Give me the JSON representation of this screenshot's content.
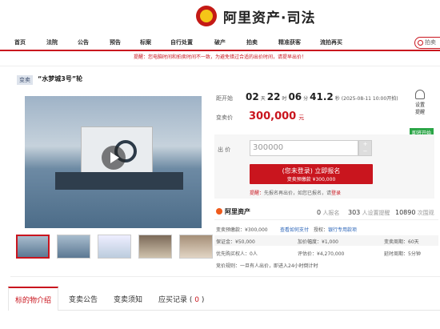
{
  "brand": {
    "name": "阿里资产·司法"
  },
  "nav": {
    "items": [
      "首页",
      "法院",
      "公告",
      "预告",
      "标案",
      "自行处置",
      "破产",
      "拍卖",
      "精准获客",
      "流拍再买"
    ],
    "search_placeholder": "拍卖"
  },
  "notice": "提醒：您电脑时间和拍卖时间不一致，为避免错过合适的出价时间，请提早出价！",
  "item": {
    "tag": "变卖",
    "title": "“水梦城3号”轮"
  },
  "countdown": {
    "label": "距开始",
    "days": "02",
    "d_unit": "天",
    "hours": "22",
    "h_unit": "时",
    "mins": "06",
    "m_unit": "分",
    "secs": "41.2",
    "s_unit": "秒",
    "date": "(2025-08-11 10:00开拍)"
  },
  "price": {
    "label": "变卖价",
    "value": "300,000",
    "unit": "元"
  },
  "remind": {
    "line1": "设置",
    "line2": "提醒"
  },
  "status_badge": "即将开始",
  "bid": {
    "label": "出 价",
    "value": "300000",
    "plus": "+",
    "minus": "−"
  },
  "register_button": {
    "line1": "(您未登录) 立即报名",
    "line2": "变卖预缴款 ¥300,000"
  },
  "tip": {
    "prefix": "提醒：",
    "text": "先报名再出价，如您已报名，请",
    "link": "登录"
  },
  "seller": {
    "name": "阿里资产"
  },
  "stats": {
    "applicants_n": "0",
    "applicants": "人报名",
    "reminders_n": "303",
    "reminders": "人设置提醒",
    "views_n": "10890",
    "views": "次围观"
  },
  "info": {
    "deposit_label": "变卖预缴款：¥300,000",
    "pay_link": "查看如何支付",
    "proxy": "授权：",
    "bank": "银行专用款项",
    "margin": "保证金：¥50,000",
    "increment": "加价幅度：¥1,000",
    "period": "变卖周期：60天",
    "priority": "优先购买权人：0人",
    "assess": "评估价：¥4,270,000",
    "delay": "延时周期：5分钟",
    "rule": "竞价规则：一旦有人出价，即进入24小时倒计时"
  },
  "tabs": {
    "t1": "标的物介绍",
    "t2": "变卖公告",
    "t3": "变卖须知",
    "t4": "应买记录",
    "count": "0"
  }
}
